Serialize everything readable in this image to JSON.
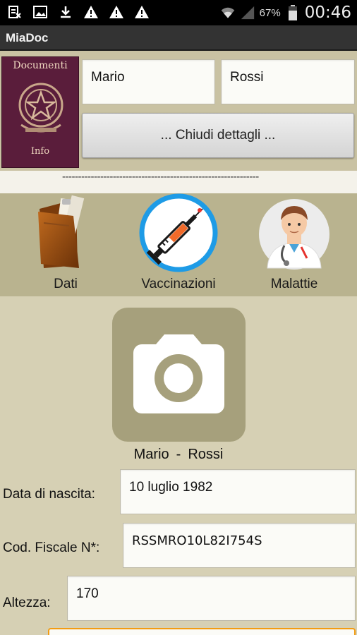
{
  "status_bar": {
    "icons": [
      "sim-card-icon",
      "image-icon",
      "download-icon",
      "warning-icon",
      "warning-icon",
      "warning-icon",
      "wifi-icon",
      "signal-icon",
      "battery-icon"
    ],
    "battery": "67%",
    "time": "00:46"
  },
  "app": {
    "title": "MiaDoc"
  },
  "logo": {
    "title": "Documenti",
    "subtitle": "Info"
  },
  "person": {
    "first_name": "Mario",
    "last_name": "Rossi"
  },
  "header": {
    "close_details_label": "... Chiudi dettagli ...",
    "separator": "--------------------------------------------------------------"
  },
  "nav": [
    {
      "label": "Dati",
      "icon": "folder-icon"
    },
    {
      "label": "Vaccinazioni",
      "icon": "syringe-icon"
    },
    {
      "label": "Malattie",
      "icon": "doctor-icon"
    }
  ],
  "profile": {
    "photo_icon": "camera-icon",
    "first_name": "Mario",
    "separator": "-",
    "last_name": "Rossi"
  },
  "fields": {
    "birth_label": "Data di nascita:",
    "birth_value": "10 luglio 1982",
    "cf_label": "Cod. Fiscale N*:",
    "cf_value": "RSSMRO10L82I754S",
    "height_label": "Altezza:",
    "height_value": "170"
  },
  "colors": {
    "accent_ring": "#1e9be6",
    "active_field_border": "#f39c12",
    "photo_bg": "#a6a07c",
    "nav_bg": "#b9b38f"
  }
}
